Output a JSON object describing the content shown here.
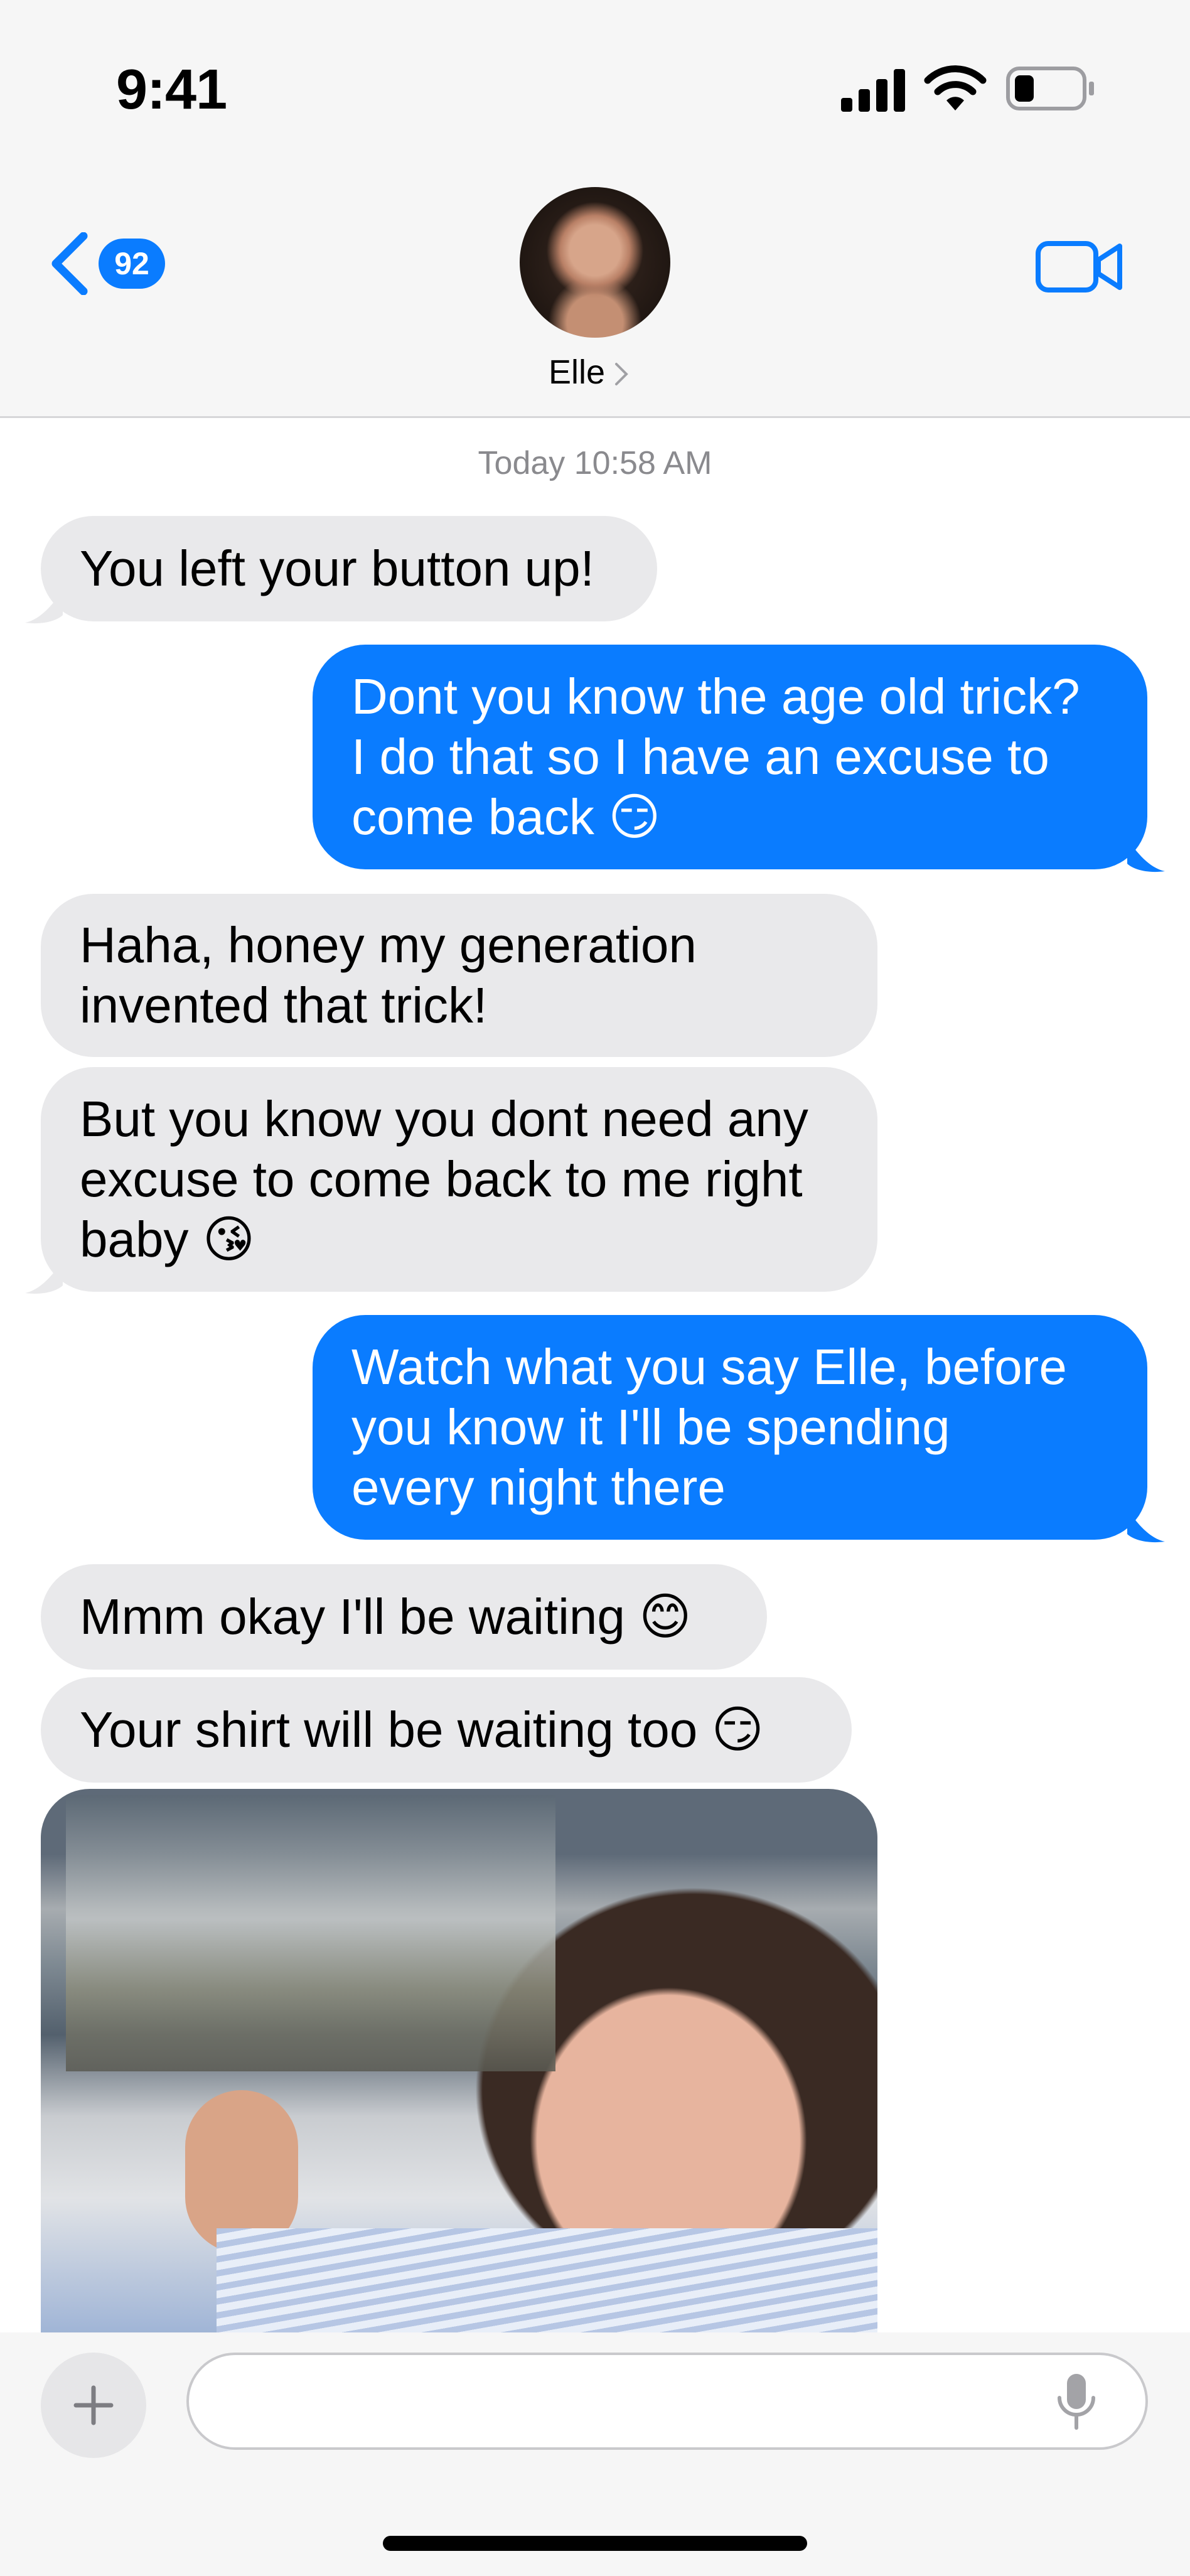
{
  "status_bar": {
    "time": "9:41"
  },
  "nav": {
    "back_badge": "92",
    "contact_name": "Elle"
  },
  "thread": {
    "timestamp": "Today 10:58 AM",
    "messages": [
      {
        "from": "them",
        "text": "You left your button up!"
      },
      {
        "from": "me",
        "text": "Dont you know the age old trick?\nI do that so I have an excuse to\ncome back 😏"
      },
      {
        "from": "them",
        "text": "Haha, honey my generation\ninvented that trick!"
      },
      {
        "from": "them",
        "text": "But you know you dont need any\nexcuse to come back to me right\nbaby 😘"
      },
      {
        "from": "me",
        "text": "Watch what you say Elle, before\nyou know it I'll be spending\nevery night there"
      },
      {
        "from": "them",
        "text": "Mmm okay I'll be waiting 😊"
      },
      {
        "from": "them",
        "text": "Your shirt will be waiting too 😏"
      }
    ]
  },
  "composer": {
    "placeholder": ""
  },
  "colors": {
    "accent": "#0a7cff",
    "incoming_bubble": "#e9e9eb",
    "header_bg": "#f6f6f6"
  },
  "icons": [
    "signal-icon",
    "wifi-icon",
    "battery-icon",
    "back-chevron-icon",
    "video-call-icon",
    "plus-icon",
    "microphone-icon"
  ]
}
